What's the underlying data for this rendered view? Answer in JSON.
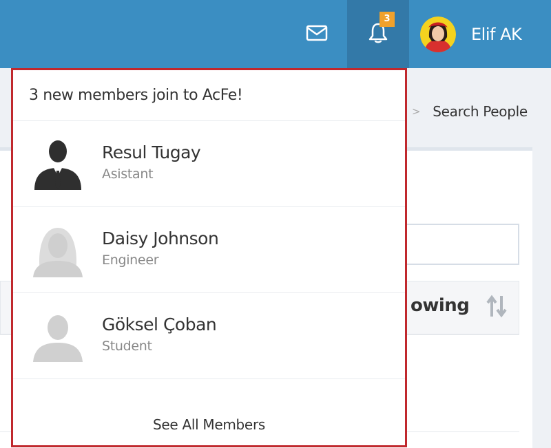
{
  "header": {
    "notification_count": "3",
    "user_name": "Elif AK",
    "icons": {
      "mail": "envelope-icon",
      "notifications": "bell-icon"
    }
  },
  "breadcrumb": {
    "separator": ">",
    "current": "Search People"
  },
  "table": {
    "partial_column_label": "owing"
  },
  "dropdown": {
    "title": "3 new members join to AcFe!",
    "members": [
      {
        "name": "Resul Tugay",
        "role": "Asistant",
        "avatar": "male-suit-avatar"
      },
      {
        "name": "Daisy Johnson",
        "role": "Engineer",
        "avatar": "female-placeholder-avatar"
      },
      {
        "name": "Göksel Çoban",
        "role": "Student",
        "avatar": "default-placeholder-avatar"
      }
    ],
    "see_all_label": "See All Members"
  },
  "colors": {
    "header_bg": "#3b8ec2",
    "badge": "#f0a12c",
    "highlight_border": "#c0282d"
  }
}
